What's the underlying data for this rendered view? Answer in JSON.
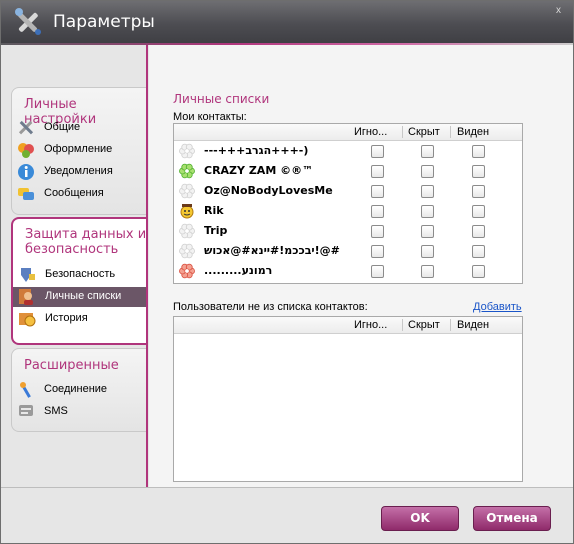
{
  "window": {
    "title": "Параметры",
    "close_glyph": "x"
  },
  "sidebar": {
    "groups": [
      {
        "title": "Личные настройки",
        "items": [
          {
            "label": "Общие",
            "icon": "tools-icon"
          },
          {
            "label": "Оформление",
            "icon": "palette-icon"
          },
          {
            "label": "Уведомления",
            "icon": "info-icon"
          },
          {
            "label": "Сообщения",
            "icon": "messages-icon"
          }
        ]
      },
      {
        "title_line1": "Защита данных и",
        "title_line2": "безопасность",
        "items": [
          {
            "label": "Безопасность",
            "icon": "shield-icon"
          },
          {
            "label": "Личные списки",
            "icon": "user-list-icon",
            "selected": true
          },
          {
            "label": "История",
            "icon": "history-icon"
          }
        ]
      },
      {
        "title": "Расширенные",
        "items": [
          {
            "label": "Соединение",
            "icon": "connection-icon"
          },
          {
            "label": "SMS",
            "icon": "sms-icon"
          }
        ]
      }
    ]
  },
  "main": {
    "title": "Личные списки",
    "contacts_label": "Мои контакты:",
    "columns": [
      "Игно...",
      "Скрыт",
      "Виден"
    ],
    "contacts": [
      {
        "name": "(-+++הגרב+++---",
        "status": "offline"
      },
      {
        "name": "CRAZY ZAM ©®™",
        "status": "online"
      },
      {
        "name": "Oz@NoBodyLovesMe",
        "status": "offline"
      },
      {
        "name": "Rik",
        "status": "away"
      },
      {
        "name": "Trip",
        "status": "offline"
      },
      {
        "name": "#@!יבככמ!#יינא#@אכוש",
        "status": "offline"
      },
      {
        "name": "רמונע.........",
        "status": "unavailable"
      }
    ],
    "noncontacts_label": "Пользователи не из списка контактов:",
    "add_link": "Добавить"
  },
  "buttons": {
    "ok": "OK",
    "cancel": "Отмена"
  },
  "colors": {
    "accent": "#b0357c",
    "selected": "#6b5667",
    "link": "#1a55c8"
  }
}
